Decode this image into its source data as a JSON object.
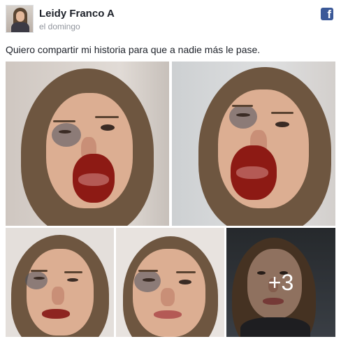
{
  "post": {
    "author_name": "Leidy Franco A",
    "timestamp": "el domingo",
    "message": "Quiero compartir mi historia para que a nadie más le pase.",
    "source_icon": "facebook-icon",
    "brand_color": "#3b5998"
  },
  "photos": {
    "count_total": 8,
    "visible": 5,
    "more_label": "+3"
  }
}
